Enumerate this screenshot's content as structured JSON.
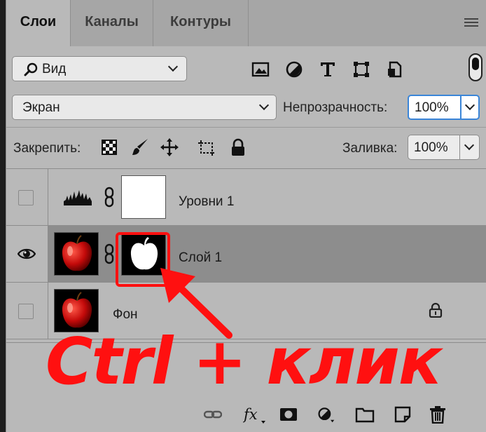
{
  "tabs": [
    {
      "label": "Слои",
      "active": true
    },
    {
      "label": "Каналы",
      "active": false
    },
    {
      "label": "Контуры",
      "active": false
    }
  ],
  "filter": {
    "kind_label": "Вид",
    "icons": [
      "image-filter-icon",
      "adjustment-filter-icon",
      "type-filter-icon",
      "shape-filter-icon",
      "smart-object-filter-icon"
    ]
  },
  "blend": {
    "mode": "Экран",
    "opacity_label": "Непрозрачность:",
    "opacity_value": "100%"
  },
  "lock": {
    "label": "Закрепить:",
    "icons": [
      "lock-transparent-icon",
      "lock-image-icon",
      "lock-position-icon",
      "lock-artboard-icon",
      "lock-all-icon"
    ]
  },
  "fill": {
    "label": "Заливка:",
    "value": "100%"
  },
  "layers": [
    {
      "name": "Уровни 1",
      "type": "adjustment",
      "visible": false,
      "selected": false
    },
    {
      "name": "Слой 1",
      "type": "masked-image",
      "visible": true,
      "selected": true
    },
    {
      "name": "Фон",
      "type": "background",
      "visible": false,
      "selected": false,
      "locked": true
    }
  ],
  "annotation": "Ctrl + клик",
  "footer_icons": [
    "link-layers-icon",
    "fx-icon",
    "add-mask-icon",
    "new-adjustment-icon",
    "new-group-icon",
    "new-layer-icon",
    "delete-icon"
  ],
  "colors": {
    "highlight": "#ff1010",
    "focus": "#3a85d8",
    "selected_row": "#8d8d8d"
  }
}
